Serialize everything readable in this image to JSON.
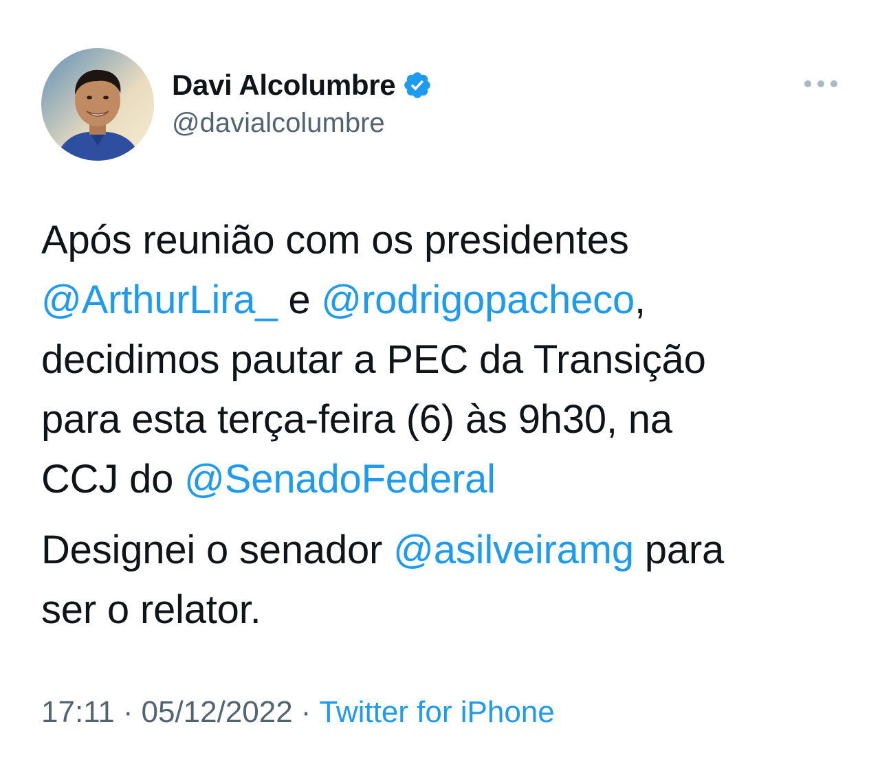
{
  "author": {
    "display_name": "Davi Alcolumbre",
    "handle": "@davialcolumbre",
    "verified": true,
    "avatar_icon": "profile-photo"
  },
  "tweet": {
    "paragraph1": {
      "line1": {
        "text": "Após reunião com os presidentes"
      },
      "line2": {
        "mention1": "@ArthurLira_",
        "text1": " e ",
        "mention2": "@rodrigopacheco",
        "text2": ","
      },
      "line3": {
        "text": "decidimos pautar a PEC da Transição"
      },
      "line4": {
        "text": "para esta terça-feira (6) às 9h30, na"
      },
      "line5": {
        "text": "CCJ do ",
        "mention": "@SenadoFederal"
      }
    },
    "paragraph2": {
      "line1": {
        "text1": "Designei o senador ",
        "mention": "@asilveiramg",
        "text2": " para"
      },
      "line2": {
        "text": "ser o relator."
      }
    }
  },
  "meta": {
    "time": "17:11",
    "separator": "·",
    "date": "05/12/2022",
    "source": "Twitter for iPhone"
  },
  "colors": {
    "mention": "#1d9bf0",
    "text": "#0f1419",
    "secondary": "#536471",
    "verified": "#1d9bf0"
  },
  "icons": {
    "verified": "verified-badge-icon",
    "more": "more-options-icon"
  }
}
